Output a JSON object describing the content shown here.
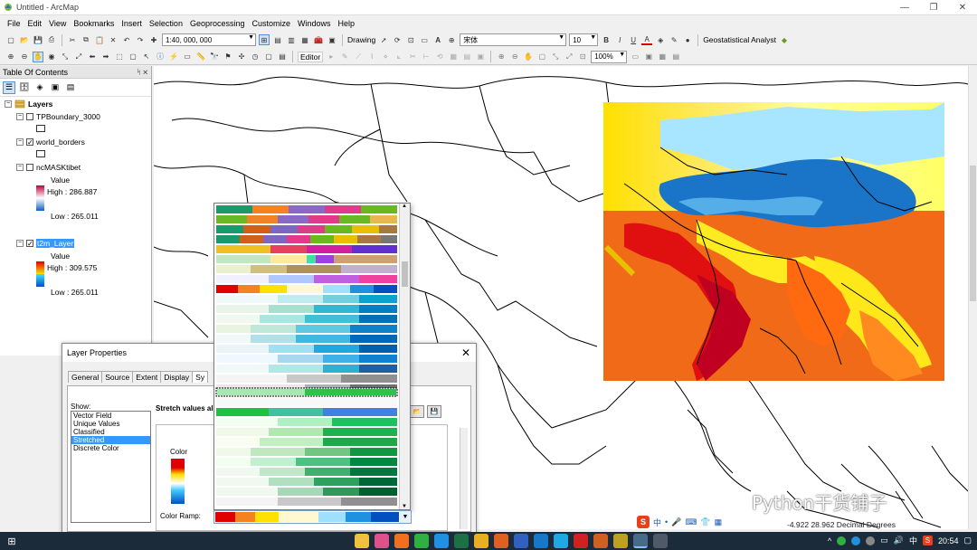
{
  "window": {
    "title": "Untitled - ArcMap",
    "min": "—",
    "max": "❐",
    "close": "✕"
  },
  "menu": [
    "File",
    "Edit",
    "View",
    "Bookmarks",
    "Insert",
    "Selection",
    "Geoprocessing",
    "Customize",
    "Windows",
    "Help"
  ],
  "toolbar": {
    "scale": "1:40, 000, 000",
    "drawing_label": "Drawing",
    "font_name": "宋体",
    "font_size": "10",
    "bold": "B",
    "italic": "I",
    "underline": "U",
    "font_color": "A",
    "geostat_label": "Geostatistical Analyst",
    "editor_label": "Editor",
    "zoom_pct": "100%"
  },
  "toc": {
    "title": "Table Of Contents",
    "pin": "ᛋ ✕",
    "layers_label": "Layers",
    "items": [
      {
        "name": "TPBoundary_3000",
        "checked": false
      },
      {
        "name": "world_borders",
        "checked": true
      },
      {
        "name": "ncMASKtibet",
        "checked": false,
        "value_label": "Value",
        "high": "High : 286.887",
        "low": "Low : 265.011"
      },
      {
        "name": "t2m_Layer",
        "checked": true,
        "value_label": "Value",
        "high": "High : 309.575",
        "low": "Low : 265.011"
      }
    ]
  },
  "dialog": {
    "title": "Layer Properties",
    "close": "✕",
    "tabs": [
      "General",
      "Source",
      "Extent",
      "Display",
      "Sy"
    ],
    "show_label": "Show:",
    "show_items": [
      "Vector Field",
      "Unique Values",
      "Classified",
      "Stretched",
      "Discrete Color"
    ],
    "selected_show": "Stretched",
    "stretch_label": "Stretch values al",
    "color_label": "Color",
    "color_ramp_label": "Color Ramp:"
  },
  "status": {
    "coords": "-4.922  28.962 Decimal Degrees"
  },
  "ime": {
    "sogou": "S",
    "zh": "中",
    "dot": "•",
    "mic": "🎤",
    "kbd": "⌨",
    "shirt": "👕",
    "grid": "▦"
  },
  "watermark": "Python干货铺子",
  "taskbar": {
    "time": "20:54",
    "lang": "中",
    "s_icon": "S"
  },
  "colors": {
    "accent": "#3399ff",
    "taskbar": "#1c2b3a"
  }
}
